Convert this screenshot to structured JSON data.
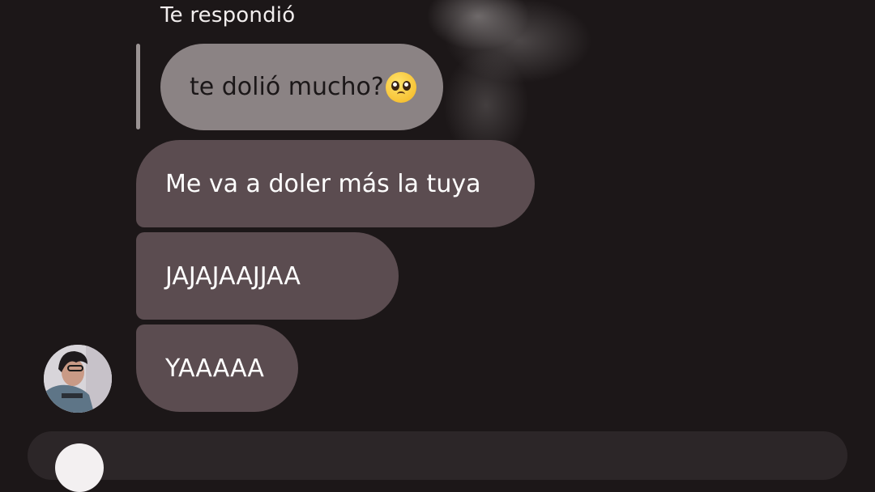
{
  "thread": {
    "reply_header": "Te respondió",
    "quoted_message": {
      "text": "te dolió mucho?",
      "emoji": "pleading-face-icon"
    },
    "messages": [
      {
        "text": "Me va a doler más la tuya"
      },
      {
        "text": "JAJAJAAJJAA"
      },
      {
        "text": "YAAAAA"
      }
    ]
  },
  "colors": {
    "background": "#1c1718",
    "quoted_bubble": "#8b8384",
    "message_bubble": "#5b4c50",
    "reply_bar": "#9a9393",
    "text_light": "#ffffff"
  }
}
